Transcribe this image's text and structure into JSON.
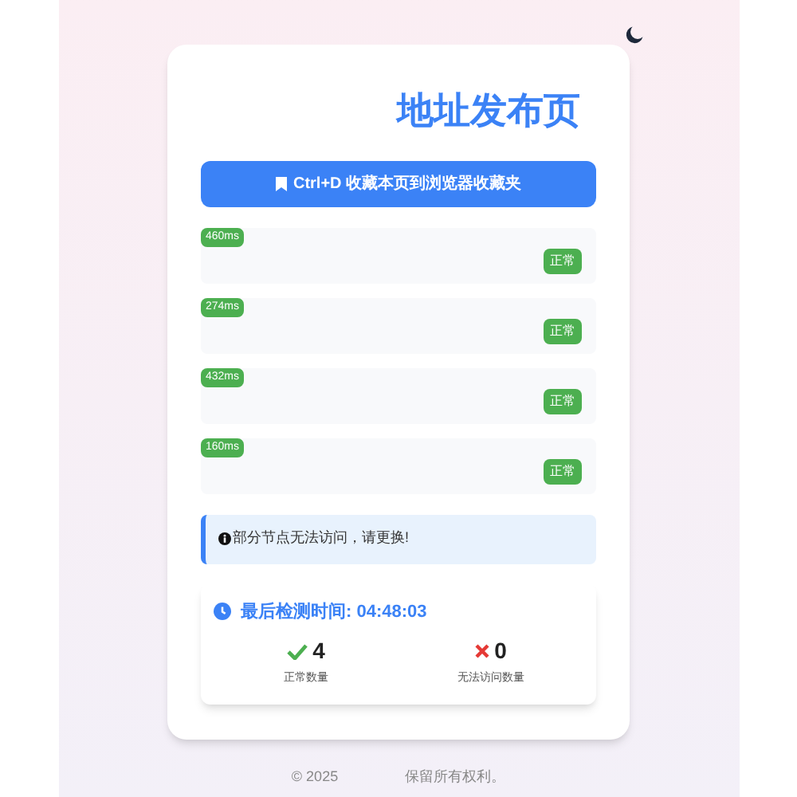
{
  "title": "地址发布页",
  "bookmark_button": {
    "label": "Ctrl+D 收藏本页到浏览器收藏夹"
  },
  "nodes": [
    {
      "latency": "460ms",
      "status": "正常"
    },
    {
      "latency": "274ms",
      "status": "正常"
    },
    {
      "latency": "432ms",
      "status": "正常"
    },
    {
      "latency": "160ms",
      "status": "正常"
    }
  ],
  "notice": "部分节点无法访问，请更换!",
  "check": {
    "label": "最后检测时间: 04:48:03",
    "ok_count": "4",
    "ok_label": "正常数量",
    "fail_count": "0",
    "fail_label": "无法访问数量"
  },
  "footer": {
    "copyright": "© 2025",
    "rights": "保留所有权利。"
  }
}
